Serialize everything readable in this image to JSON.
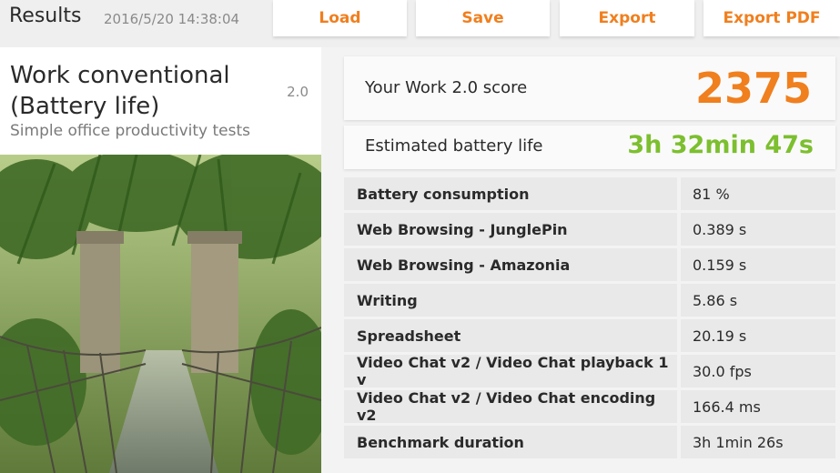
{
  "header": {
    "title": "Results",
    "timestamp": "2016/5/20 14:38:04",
    "buttons": {
      "load": "Load",
      "save": "Save",
      "export": "Export",
      "export_pdf": "Export PDF"
    }
  },
  "test": {
    "title": "Work conventional (Battery life)",
    "version": "2.0",
    "subtitle": "Simple office productivity tests"
  },
  "score": {
    "label": "Your Work 2.0 score",
    "value": "2375"
  },
  "battery": {
    "label": "Estimated battery life",
    "value": "3h 32min 47s"
  },
  "results": [
    {
      "name": "Battery consumption",
      "value": "81 %"
    },
    {
      "name": "Web Browsing - JunglePin",
      "value": "0.389 s"
    },
    {
      "name": "Web Browsing - Amazonia",
      "value": "0.159 s"
    },
    {
      "name": "Writing",
      "value": "5.86 s"
    },
    {
      "name": "Spreadsheet",
      "value": "20.19 s"
    },
    {
      "name": "Video Chat v2 / Video Chat playback 1 v",
      "value": "30.0 fps"
    },
    {
      "name": "Video Chat v2 / Video Chat encoding v2",
      "value": "166.4 ms"
    },
    {
      "name": "Benchmark duration",
      "value": "3h 1min 26s"
    }
  ],
  "colors": {
    "accent": "#f07f1e",
    "battery": "#7cbf2f"
  }
}
